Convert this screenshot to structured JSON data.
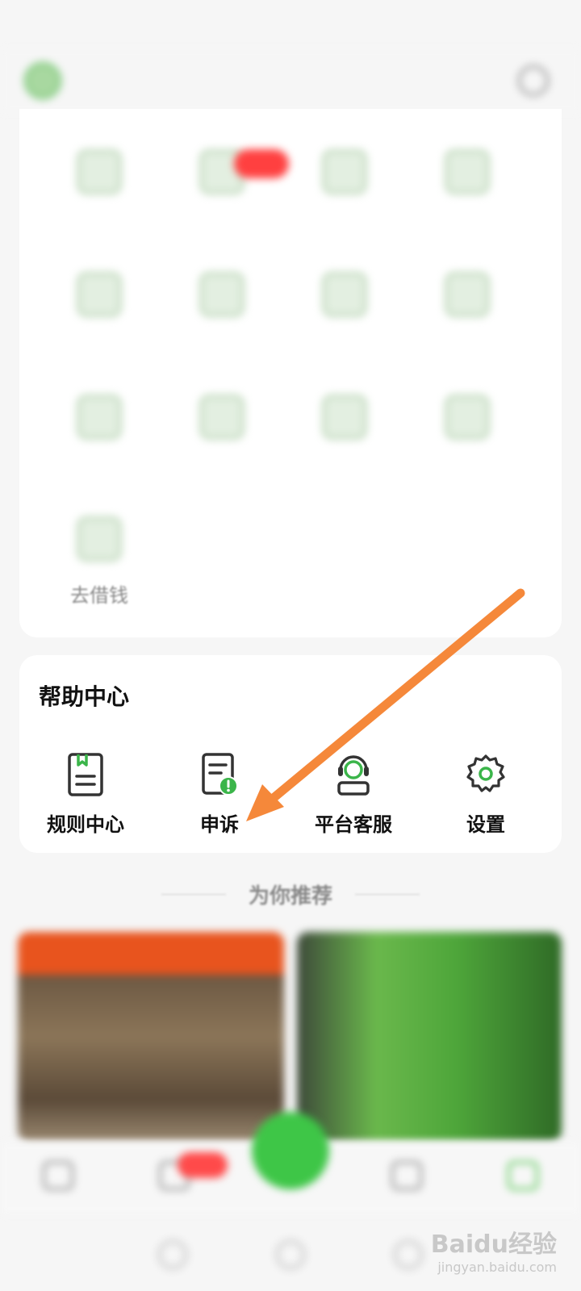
{
  "status_bar": {
    "left": "",
    "right": ""
  },
  "nav": {
    "title": "",
    "right_label": ""
  },
  "grid_section": {
    "subheading": "",
    "items": [
      {
        "label": ""
      },
      {
        "label": ""
      },
      {
        "label": ""
      },
      {
        "label": ""
      },
      {
        "label": ""
      },
      {
        "label": ""
      },
      {
        "label": ""
      },
      {
        "label": ""
      },
      {
        "label": ""
      },
      {
        "label": ""
      },
      {
        "label": ""
      },
      {
        "label": ""
      },
      {
        "label": "去借钱"
      }
    ]
  },
  "help_center": {
    "title": "帮助中心",
    "items": [
      {
        "label": "规则中心",
        "icon": "rules-icon"
      },
      {
        "label": "申诉",
        "icon": "appeal-icon"
      },
      {
        "label": "平台客服",
        "icon": "customer-service-icon"
      },
      {
        "label": "设置",
        "icon": "settings-gear-icon"
      }
    ]
  },
  "recommend": {
    "title": "为你推荐"
  },
  "tabbar": {
    "items": [
      {
        "label": ""
      },
      {
        "label": ""
      },
      {
        "label": ""
      },
      {
        "label": ""
      },
      {
        "label": ""
      }
    ]
  },
  "watermark": {
    "line1": "Baidu经验",
    "line2": "jingyan.baidu.com"
  },
  "colors": {
    "accent_green": "#4cc44a",
    "arrow_orange": "#f5883a",
    "badge_red": "#ff4040"
  }
}
